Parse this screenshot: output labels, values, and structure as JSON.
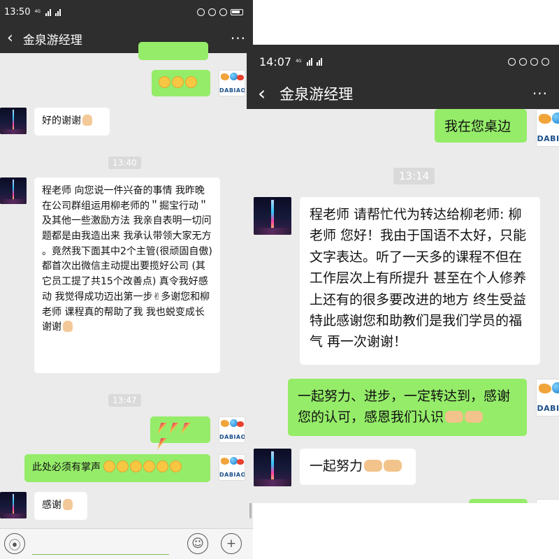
{
  "left": {
    "status": {
      "time": "13:50",
      "net": "4G"
    },
    "title": "金泉游经理",
    "more": "···",
    "msg_happy_faces": 3,
    "msg_thanks": "好的谢谢",
    "time1": "13:40",
    "msg_long": "程老师 向您说一件兴奋的事情 我昨晚在公司群组运用柳老师的＂掘宝行动＂及其他一些激励方法 我亲自表明一切问题都是由我造出来 我承认带领大家无方 。竟然我下面其中2个主管(很顽固自傲)都首次出微信主动提出要揽好公司 (其它员工提了共15个改善点) 真令我好感动 我觉得成功迈出第一步✌多谢您和柳老师 课程真的帮助了我 我也蜕变成长 谢谢",
    "time2": "13:47",
    "msg_applause": "此处必须有掌声",
    "msg_thanks2": "感谢",
    "avatar_logo_text": "DABIAO"
  },
  "right": {
    "status": {
      "time": "14:07",
      "net": "4G"
    },
    "title": "金泉游经理",
    "more": "···",
    "msg_desk": "我在您桌边",
    "time1": "13:14",
    "msg_long": "程老师 请帮忙代为转达给柳老师: 柳老师 您好！我由于国语不太好，只能文字表达。听了一天多的课程不但在工作层次上有所提升 甚至在个人修养上还有的很多要改进的地方 终生受益 特此感谢您和助教们是我们学员的福气 再一次谢谢！",
    "msg_reply": "一起努力、进步，一定转达到，感谢您的认可，感恩我们认识",
    "msg_together": "一起努力",
    "avatar_logo_text": "DABIAO"
  },
  "colors": {
    "navbar": "#2e2e2e",
    "chat_bg": "#ebebeb",
    "bubble_out": "#95ec69",
    "bubble_in": "#ffffff"
  }
}
